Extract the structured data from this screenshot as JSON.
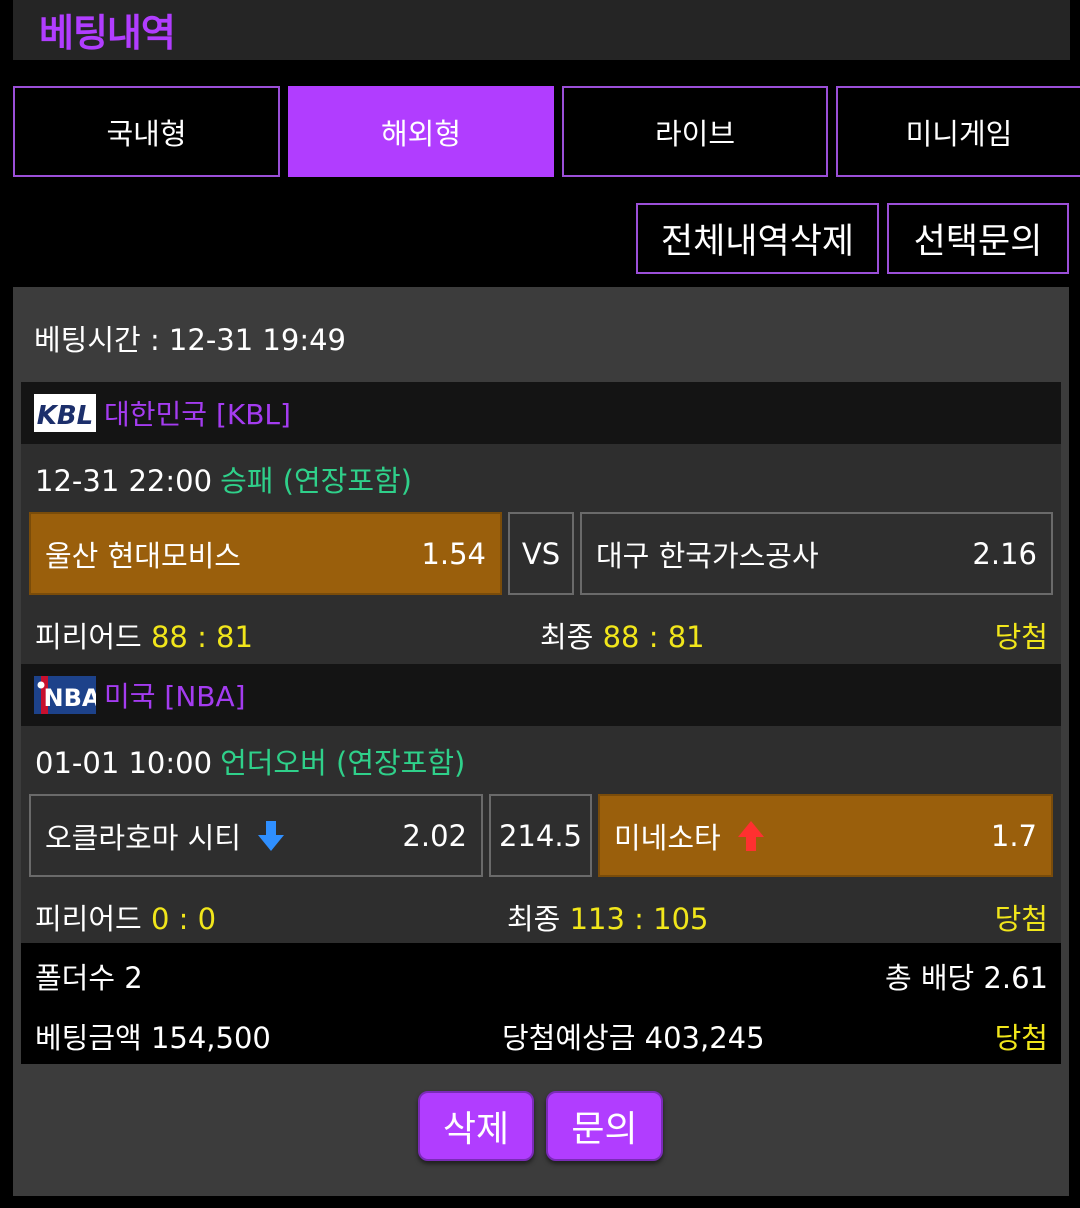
{
  "header": {
    "title": "베팅내역"
  },
  "tabs": [
    {
      "label": "국내형",
      "active": false
    },
    {
      "label": "해외형",
      "active": true
    },
    {
      "label": "라이브",
      "active": false
    },
    {
      "label": "미니게임",
      "active": false
    }
  ],
  "actions": {
    "delete_all": "전체내역삭제",
    "inquire_selected": "선택문의"
  },
  "bet": {
    "time_label": "베팅시간 : 12-31 19:49",
    "games": [
      {
        "league": "대한민국 [KBL]",
        "logo_text": "KBL",
        "match_time": "12-31 22:00",
        "bet_type": "승패 (연장포함)",
        "home": {
          "name": "울산 현대모비스",
          "odds": "1.54",
          "selected": true
        },
        "center": "VS",
        "away": {
          "name": "대구 한국가스공사",
          "odds": "2.16",
          "selected": false
        },
        "period_label": "피리어드",
        "period_score": "88 : 81",
        "final_label": "최종",
        "final_score": "88 : 81",
        "result": "당첨"
      },
      {
        "league": "미국 [NBA]",
        "logo_text": "NBA",
        "match_time": "01-01 10:00",
        "bet_type": "언더오버 (연장포함)",
        "home": {
          "name": "오클라호마 시티",
          "odds": "2.02",
          "selected": false,
          "arrow": "down"
        },
        "center": "214.5",
        "away": {
          "name": "미네소타",
          "odds": "1.7",
          "selected": true,
          "arrow": "up"
        },
        "period_label": "피리어드",
        "period_score": "0 : 0",
        "final_label": "최종",
        "final_score": "113 : 105",
        "result": "당첨"
      }
    ],
    "folders": "폴더수 2",
    "total_odds": "총 배당 2.61",
    "bet_amount": "베팅금액 154,500",
    "expected_win": "당첨예상금 403,245",
    "status": "당첨"
  },
  "buttons": {
    "delete": "삭제",
    "inquire": "문의"
  },
  "colors": {
    "accent": "#b13dff",
    "selected": "#9a5f0c",
    "win": "#f1e61b",
    "bet_type": "#2fd08a",
    "arrow_down": "#2f8fff",
    "arrow_up": "#ff3030"
  }
}
